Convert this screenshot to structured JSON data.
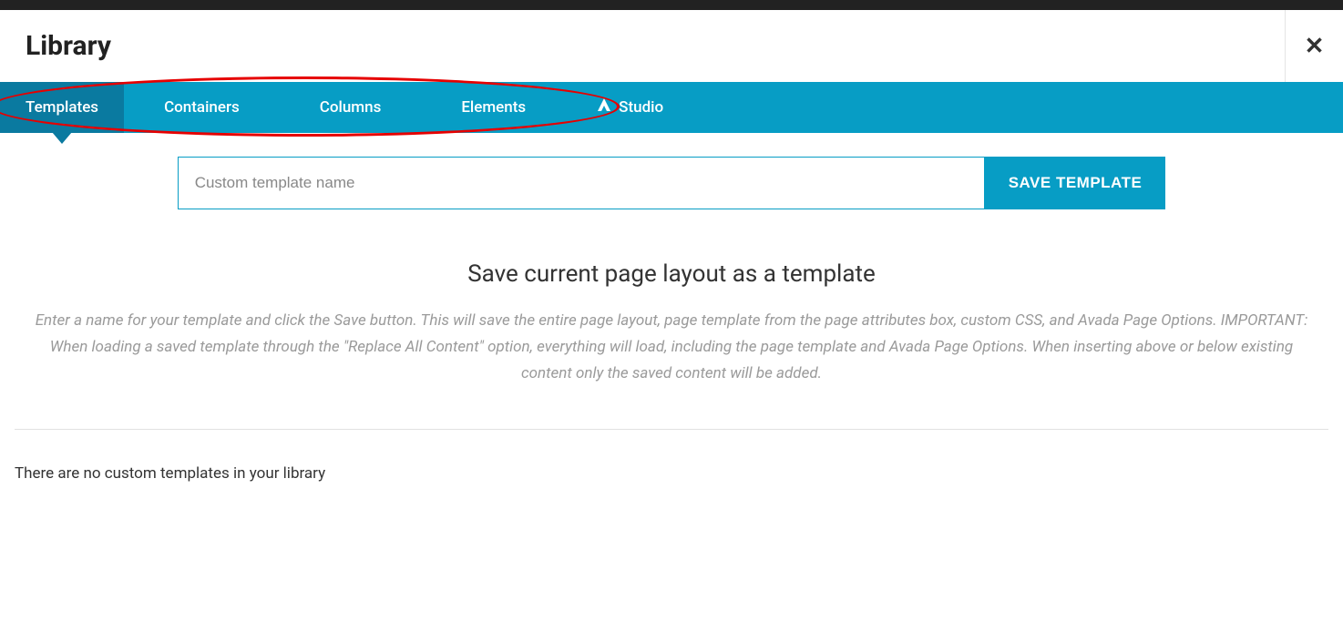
{
  "header": {
    "title": "Library"
  },
  "tabs": {
    "items": [
      {
        "label": "Templates",
        "active": true
      },
      {
        "label": "Containers",
        "active": false
      },
      {
        "label": "Columns",
        "active": false
      },
      {
        "label": "Elements",
        "active": false
      },
      {
        "label": "Studio",
        "active": false,
        "hasIcon": true
      }
    ]
  },
  "form": {
    "placeholder": "Custom template name",
    "button_label": "Save Template"
  },
  "section": {
    "heading": "Save current page layout as a template",
    "description": "Enter a name for your template and click the Save button. This will save the entire page layout, page template from the page attributes box, custom CSS, and Avada Page Options. IMPORTANT: When loading a saved template through the \"Replace All Content\" option, everything will load, including the page template and Avada Page Options. When inserting above or below existing content only the saved content will be added."
  },
  "library": {
    "empty_message": "There are no custom templates in your library"
  },
  "colors": {
    "primary": "#079dc5",
    "primary_dark": "#0a7aa0",
    "annotation": "#e60000"
  }
}
